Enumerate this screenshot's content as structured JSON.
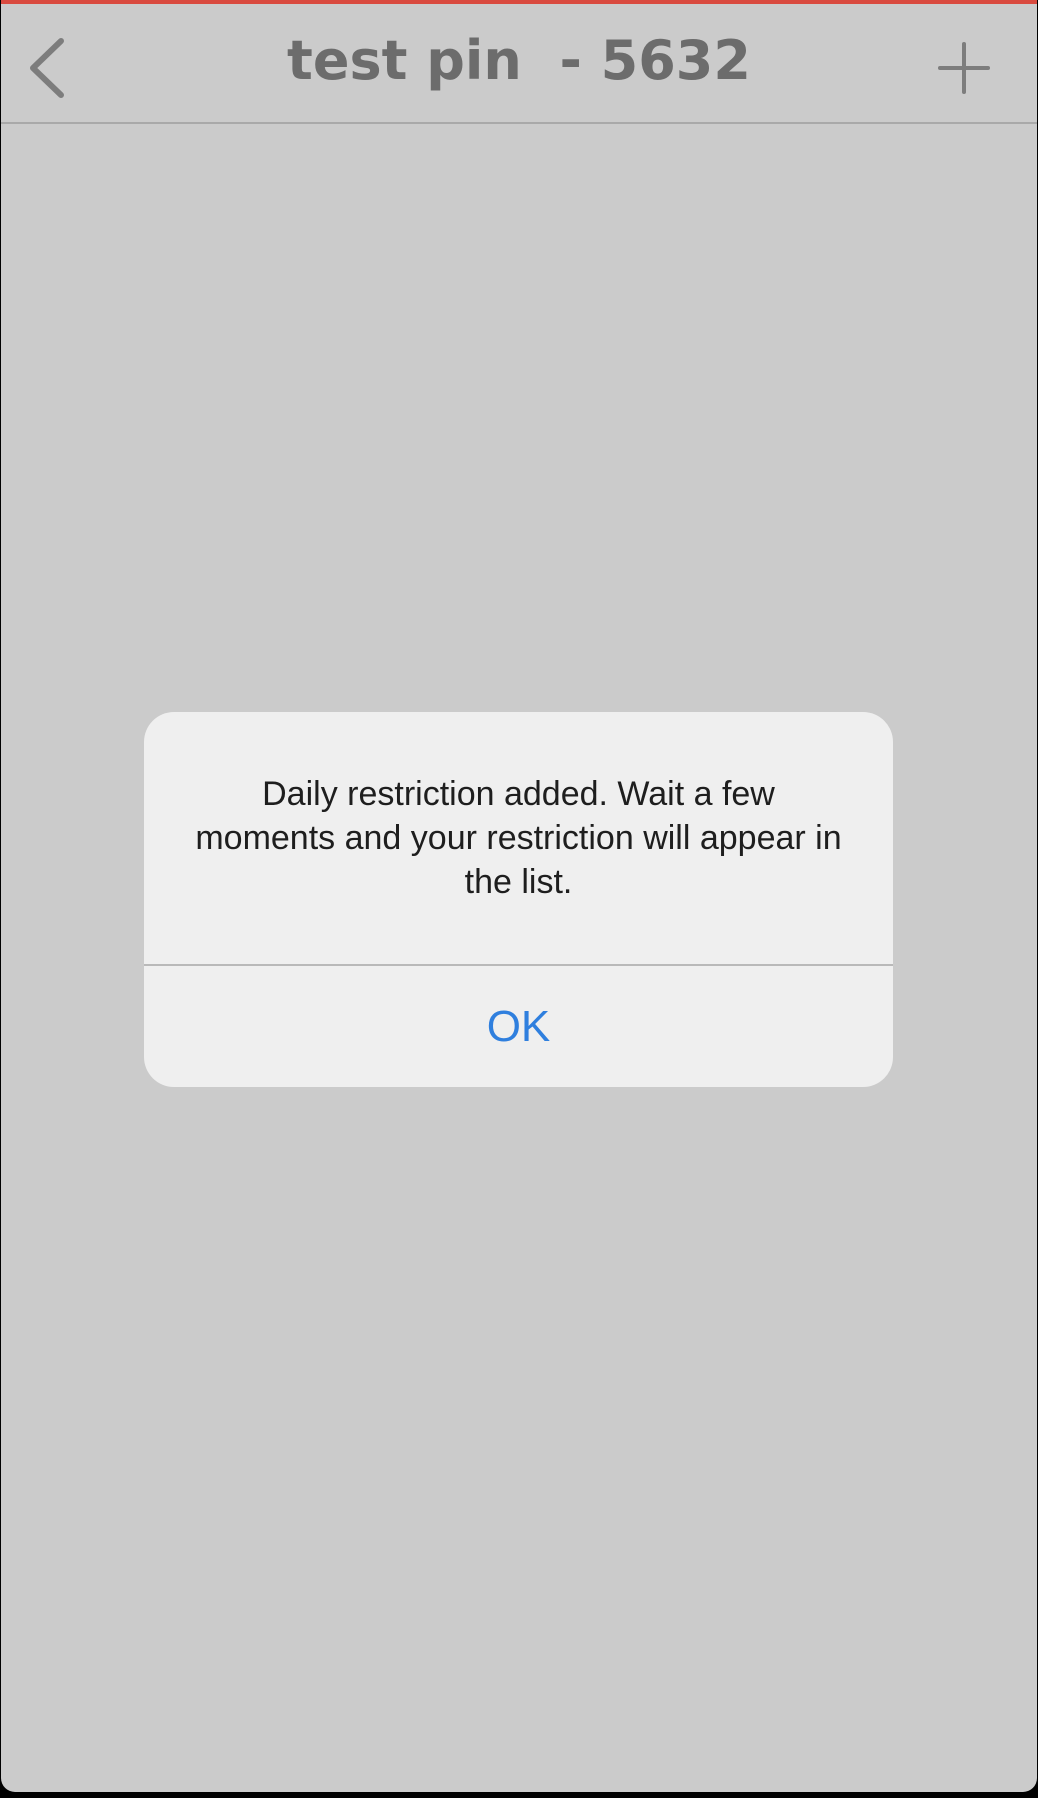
{
  "colors": {
    "accent_bar": "#d94a3f",
    "nav_icon": "#7d7d7d",
    "alert_button": "#2f7fde"
  },
  "header": {
    "title": "test pin  - 5632",
    "back_icon": "chevron-left-icon",
    "add_icon": "plus-icon"
  },
  "alert": {
    "message": "Daily restriction added. Wait a few moments and your restriction will appear in the list.",
    "ok_label": "OK"
  }
}
